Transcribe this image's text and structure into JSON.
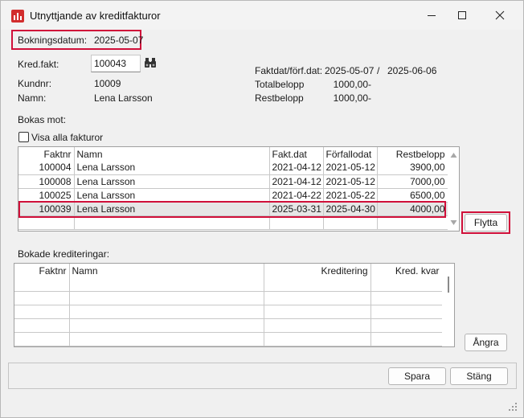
{
  "window": {
    "title": "Utnyttjande av kreditfakturor",
    "controls": {
      "minimize": "—",
      "maximize": "☐",
      "close": "✕"
    }
  },
  "header": {
    "bokningsdatum_label": "Bokningsdatum:",
    "bokningsdatum_value": "2025-05-07",
    "kredfakt_label": "Kred.fakt:",
    "kredfakt_value": "100043",
    "kundnr_label": "Kundnr:",
    "kundnr_value": "10009",
    "namn_label": "Namn:",
    "namn_value": "Lena Larsson",
    "faktdat_label": "Faktdat/förf.dat:",
    "faktdat_value": "2025-05-07",
    "separator": "/",
    "forfdat_value": "2025-06-06",
    "totalbelopp_label": "Totalbelopp",
    "totalbelopp_value": "1000,00-",
    "restbelopp_label": "Restbelopp",
    "restbelopp_value": "1000,00-"
  },
  "bokas_mot": {
    "section_label": "Bokas mot:",
    "show_all_label": "Visa alla fakturor",
    "show_all_checked": false,
    "columns": [
      "Faktnr",
      "Namn",
      "Fakt.dat",
      "Förfallodat",
      "Restbelopp"
    ],
    "rows": [
      [
        "100004",
        "Lena Larsson",
        "2021-04-12",
        "2021-05-12",
        "3900,00"
      ],
      [
        "100008",
        "Lena Larsson",
        "2021-04-12",
        "2021-05-12",
        "7000,00"
      ],
      [
        "100025",
        "Lena Larsson",
        "2021-04-22",
        "2021-05-22",
        "6500,00"
      ],
      [
        "100039",
        "Lena Larsson",
        "2025-03-31",
        "2025-04-30",
        "4000,00"
      ]
    ],
    "selected_row": 3,
    "move_button": "Flytta"
  },
  "bokade": {
    "section_label": "Bokade krediteringar:",
    "columns": [
      "Faktnr",
      "Namn",
      "Kreditering",
      "Kred. kvar"
    ],
    "undo_button": "Ångra"
  },
  "footer": {
    "save_button": "Spara",
    "close_button": "Stäng"
  },
  "colors": {
    "highlight": "#d0103a",
    "app_icon": "#d22d2d",
    "selected_row": "#e6e6e6"
  }
}
